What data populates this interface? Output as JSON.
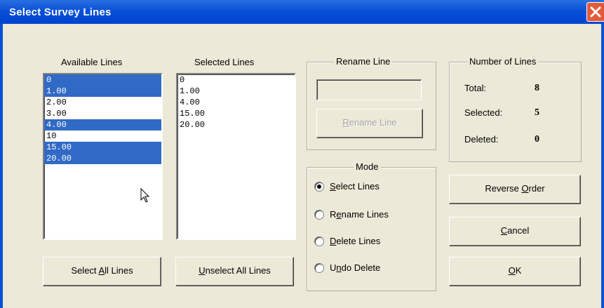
{
  "window": {
    "title": "Select Survey Lines"
  },
  "available": {
    "label": "Available Lines",
    "items": [
      {
        "text": "0",
        "selected": true
      },
      {
        "text": "1.00",
        "selected": true
      },
      {
        "text": "2.00",
        "selected": false
      },
      {
        "text": "3.00",
        "selected": false
      },
      {
        "text": "4.00",
        "selected": true
      },
      {
        "text": "10",
        "selected": false
      },
      {
        "text": "15.00",
        "selected": true
      },
      {
        "text": "20.00",
        "selected": true
      }
    ]
  },
  "selected": {
    "label": "Selected Lines",
    "items": [
      "0",
      "1.00",
      "4.00",
      "15.00",
      "20.00"
    ]
  },
  "rename": {
    "group_label": "Rename Line",
    "input_value": "",
    "button_label_pre": "",
    "button_label_key": "R",
    "button_label_post": "ename Line"
  },
  "mode": {
    "group_label": "Mode",
    "options": [
      {
        "pre": "",
        "key": "S",
        "post": "elect Lines",
        "checked": true
      },
      {
        "pre": "R",
        "key": "e",
        "post": "name Lines",
        "checked": false
      },
      {
        "pre": "",
        "key": "D",
        "post": "elete Lines",
        "checked": false
      },
      {
        "pre": "U",
        "key": "n",
        "post": "do Delete",
        "checked": false
      }
    ]
  },
  "counts": {
    "group_label": "Number of Lines",
    "total_label": "Total:",
    "total": "8",
    "selected_label": "Selected:",
    "selected": "5",
    "deleted_label": "Deleted:",
    "deleted": "0"
  },
  "buttons": {
    "select_all": {
      "pre": "Select ",
      "key": "A",
      "post": "ll Lines"
    },
    "unselect_all": {
      "pre": "",
      "key": "U",
      "post": "nselect All Lines"
    },
    "reverse": {
      "pre": "Reverse ",
      "key": "O",
      "post": "rder"
    },
    "cancel": {
      "pre": "",
      "key": "C",
      "post": "ancel"
    },
    "ok": {
      "pre": "",
      "key": "O",
      "post": "K"
    }
  },
  "colors": {
    "titlebar": "#0a50d8",
    "selection": "#316ac5",
    "dialog": "#ece9d8"
  }
}
